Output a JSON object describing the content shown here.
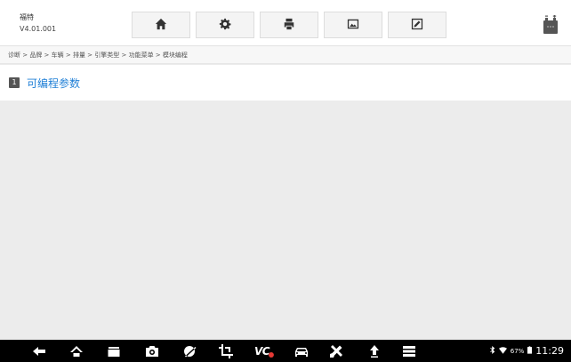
{
  "header": {
    "brand_name": "福特",
    "version": "V4.01.001",
    "buttons": [
      {
        "icon": "home-icon"
      },
      {
        "icon": "gear-icon"
      },
      {
        "icon": "print-icon"
      },
      {
        "icon": "image-icon"
      },
      {
        "icon": "edit-icon"
      }
    ],
    "battery_icon": "battery-icon"
  },
  "breadcrumb": "诊断 > 品牌 > 车辆 > 排量 > 引擎类型 > 功能菜单 > 模块编程",
  "menu": {
    "items": [
      {
        "index": "1",
        "label": "可编程参数"
      }
    ]
  },
  "navbar": {
    "vci_label": "VC",
    "status": {
      "battery_percent": "67%",
      "time": "11:29"
    }
  },
  "colors": {
    "accent": "#1f7fd6",
    "vci_dot": "#e53935"
  }
}
